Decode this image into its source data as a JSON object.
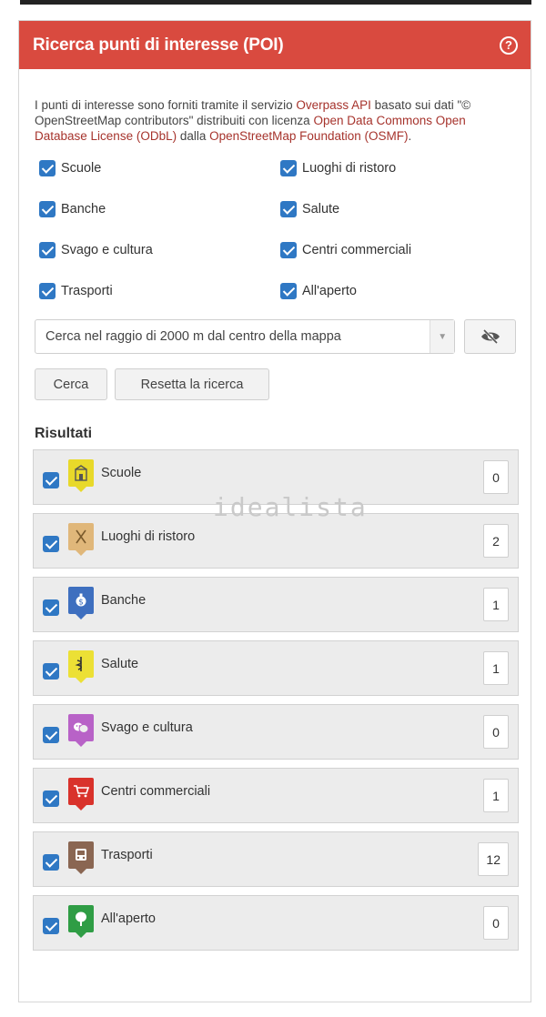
{
  "header": {
    "title": "Ricerca punti di interesse (POI)",
    "help_icon": "?"
  },
  "intro": {
    "t1": "I punti di interesse sono forniti tramite il servizio ",
    "link1": "Overpass API",
    "t2": " basato sui dati \"© OpenStreetMap contributors\" distribuiti con licenza ",
    "link2": "Open Data Commons Open Database License (ODbL)",
    "t3": " dalla ",
    "link3": "OpenStreetMap Foundation (OSMF)",
    "t4": "."
  },
  "categories": [
    {
      "label": "Scuole",
      "checked": true
    },
    {
      "label": "Luoghi di ristoro",
      "checked": true
    },
    {
      "label": "Banche",
      "checked": true
    },
    {
      "label": "Salute",
      "checked": true
    },
    {
      "label": "Svago e cultura",
      "checked": true
    },
    {
      "label": "Centri commerciali",
      "checked": true
    },
    {
      "label": "Trasporti",
      "checked": true
    },
    {
      "label": "All'aperto",
      "checked": true
    }
  ],
  "search": {
    "radius_selected": "Cerca nel raggio di 2000 m dal centro della mappa",
    "visibility_icon": "eye-slash-icon",
    "search_button": "Cerca",
    "reset_button": "Resetta la ricerca"
  },
  "results": {
    "title": "Risultati",
    "items": [
      {
        "label": "Scuole",
        "count": "0",
        "icon_color": "#e8d92a",
        "icon": "school-icon"
      },
      {
        "label": "Luoghi di ristoro",
        "count": "2",
        "icon_color": "#e0b77a",
        "icon": "restaurant-icon"
      },
      {
        "label": "Banche",
        "count": "1",
        "icon_color": "#3e6fbf",
        "icon": "bank-icon"
      },
      {
        "label": "Salute",
        "count": "1",
        "icon_color": "#ece035",
        "icon": "health-icon"
      },
      {
        "label": "Svago e cultura",
        "count": "0",
        "icon_color": "#b862c7",
        "icon": "theater-icon"
      },
      {
        "label": "Centri commerciali",
        "count": "1",
        "icon_color": "#d9322b",
        "icon": "shopping-cart-icon"
      },
      {
        "label": "Trasporti",
        "count": "12",
        "icon_color": "#8a6652",
        "icon": "bus-icon"
      },
      {
        "label": "All'aperto",
        "count": "0",
        "icon_color": "#2f9d45",
        "icon": "tree-icon"
      }
    ]
  },
  "watermark": "idealista"
}
